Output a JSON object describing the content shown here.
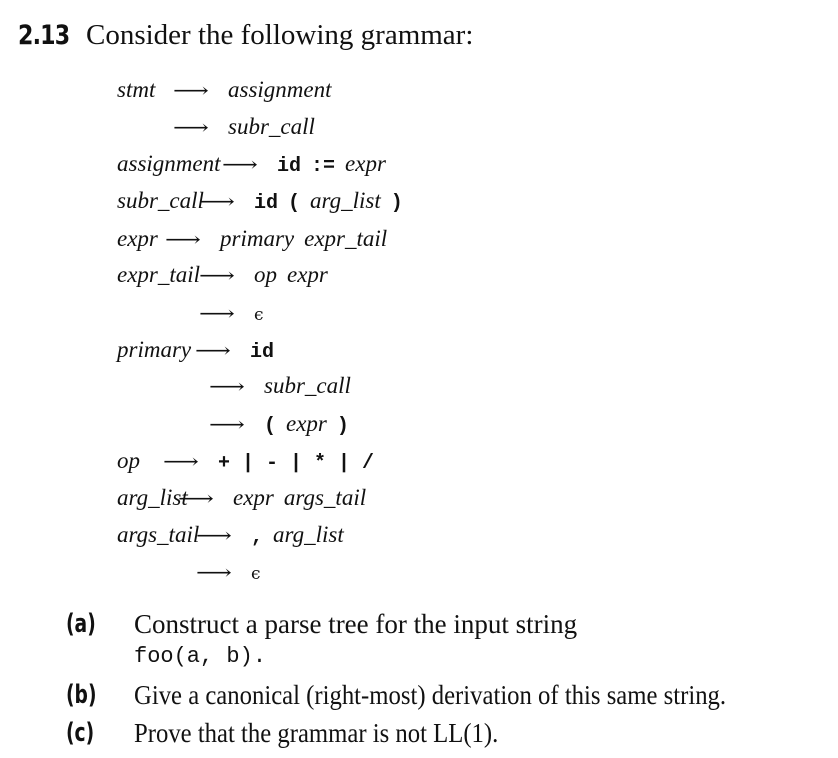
{
  "exercise": {
    "number": "2.13",
    "heading": "Consider the following grammar:"
  },
  "grammar": {
    "arrow": "⟶",
    "epsilon": "ϵ",
    "rules": [
      {
        "lhs": "stmt",
        "rhs": [
          {
            "t": "nt",
            "v": "assignment"
          }
        ]
      },
      {
        "lhs": "",
        "rhs": [
          {
            "t": "nt",
            "v": "subr_call"
          }
        ]
      },
      {
        "lhs": "assignment",
        "rhs": [
          {
            "t": "tok",
            "v": "id"
          },
          {
            "t": "tok",
            "v": ":="
          },
          {
            "t": "nt",
            "v": "expr"
          }
        ]
      },
      {
        "lhs": "subr_call",
        "rhs": [
          {
            "t": "tok",
            "v": "id"
          },
          {
            "t": "tok",
            "v": "("
          },
          {
            "t": "nt",
            "v": "arg_list"
          },
          {
            "t": "tok",
            "v": ")"
          }
        ]
      },
      {
        "lhs": "expr",
        "rhs": [
          {
            "t": "nt",
            "v": "primary"
          },
          {
            "t": "nt",
            "v": "expr_tail"
          }
        ]
      },
      {
        "lhs": "expr_tail",
        "rhs": [
          {
            "t": "nt",
            "v": "op"
          },
          {
            "t": "nt",
            "v": "expr"
          }
        ]
      },
      {
        "lhs": "",
        "rhs": [
          {
            "t": "eps",
            "v": "ϵ"
          }
        ]
      },
      {
        "lhs": "primary",
        "rhs": [
          {
            "t": "tok",
            "v": "id"
          }
        ]
      },
      {
        "lhs": "",
        "rhs": [
          {
            "t": "nt",
            "v": "subr_call"
          }
        ]
      },
      {
        "lhs": "",
        "rhs": [
          {
            "t": "tok",
            "v": "("
          },
          {
            "t": "nt",
            "v": "expr"
          },
          {
            "t": "tok",
            "v": ")"
          }
        ]
      },
      {
        "lhs": "op",
        "rhs": [
          {
            "t": "tok",
            "v": "+ | - | * | /"
          }
        ]
      },
      {
        "lhs": "arg_list",
        "rhs": [
          {
            "t": "nt",
            "v": "expr"
          },
          {
            "t": "nt",
            "v": "args_tail"
          }
        ]
      },
      {
        "lhs": "args_tail",
        "rhs": [
          {
            "t": "tok",
            "v": ","
          },
          {
            "t": "nt",
            "v": "arg_list"
          }
        ]
      },
      {
        "lhs": "",
        "rhs": [
          {
            "t": "eps",
            "v": "ϵ"
          }
        ]
      }
    ]
  },
  "parts": [
    {
      "label": "(a)",
      "text": "Construct a parse tree for the input string",
      "code": "foo(a, b)."
    },
    {
      "label": "(b)",
      "text": "Give a canonical (right-most) derivation of this same string."
    },
    {
      "label": "(c)",
      "text": "Prove that the grammar is not LL(1)."
    }
  ]
}
